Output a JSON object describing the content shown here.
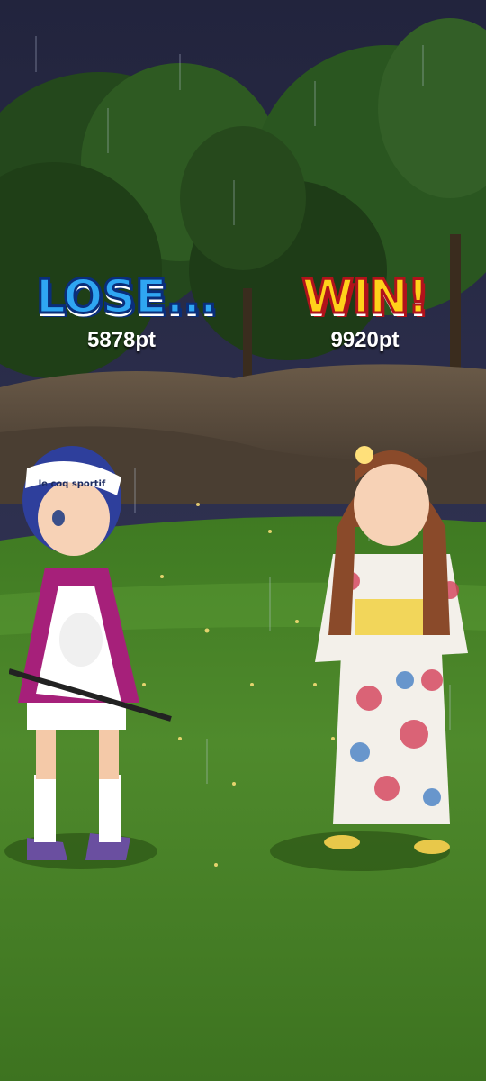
{
  "results": {
    "left": {
      "label": "LOSE...",
      "score": "5878pt"
    },
    "right": {
      "label": "WIN!",
      "score": "9920pt"
    }
  },
  "player_left": {
    "visor_text": "le coq sportif"
  },
  "colors": {
    "sky": "#2a2c48",
    "lose_fill": "#2fa6f2",
    "lose_outline": "#0a2e7a",
    "win_fill": "#ffd21a",
    "win_outline": "#b1121b",
    "grass": "#4f8a2a"
  }
}
